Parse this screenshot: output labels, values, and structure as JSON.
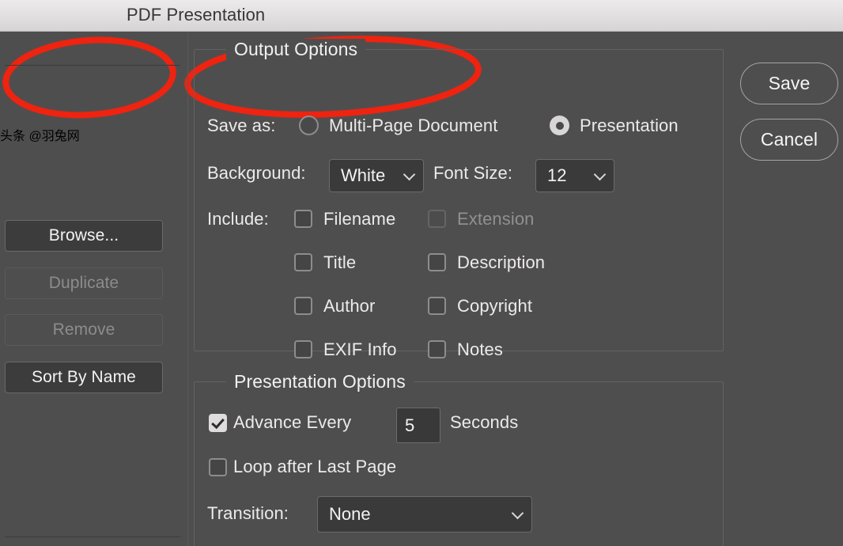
{
  "window": {
    "title": "PDF Presentation"
  },
  "colors": {
    "background": "#4f4e4e",
    "titlebar": "#e7e5e5",
    "text": "#f2f1f1",
    "disabled_text": "#8d8c8c",
    "annotation": "#ee2310"
  },
  "sidebar": {
    "buttons": [
      {
        "label": "Browse...",
        "enabled": true
      },
      {
        "label": "Duplicate",
        "enabled": false
      },
      {
        "label": "Remove",
        "enabled": false
      },
      {
        "label": "Sort By Name",
        "enabled": true
      }
    ]
  },
  "actions": {
    "save_label": "Save",
    "cancel_label": "Cancel"
  },
  "output_options": {
    "legend": "Output Options",
    "save_as": {
      "label": "Save as:",
      "options": [
        {
          "label": "Multi-Page Document",
          "selected": false
        },
        {
          "label": "Presentation",
          "selected": true
        }
      ]
    },
    "background": {
      "label": "Background:",
      "value": "White"
    },
    "font_size": {
      "label": "Font Size:",
      "value": "12"
    },
    "include": {
      "label": "Include:",
      "items": [
        {
          "label": "Filename",
          "checked": false,
          "enabled": true
        },
        {
          "label": "Extension",
          "checked": false,
          "enabled": false
        },
        {
          "label": "Title",
          "checked": false,
          "enabled": true
        },
        {
          "label": "Description",
          "checked": false,
          "enabled": true
        },
        {
          "label": "Author",
          "checked": false,
          "enabled": true
        },
        {
          "label": "Copyright",
          "checked": false,
          "enabled": true
        },
        {
          "label": "EXIF Info",
          "checked": false,
          "enabled": true
        },
        {
          "label": "Notes",
          "checked": false,
          "enabled": true
        }
      ]
    }
  },
  "presentation_options": {
    "legend": "Presentation Options",
    "advance_every": {
      "label": "Advance Every",
      "checked": true,
      "seconds_value": "5",
      "units_label": "Seconds"
    },
    "loop": {
      "label": "Loop after Last Page",
      "checked": false
    },
    "transition": {
      "label": "Transition:",
      "value": "None"
    }
  },
  "watermark": {
    "text": "头条 @羽兔网"
  }
}
